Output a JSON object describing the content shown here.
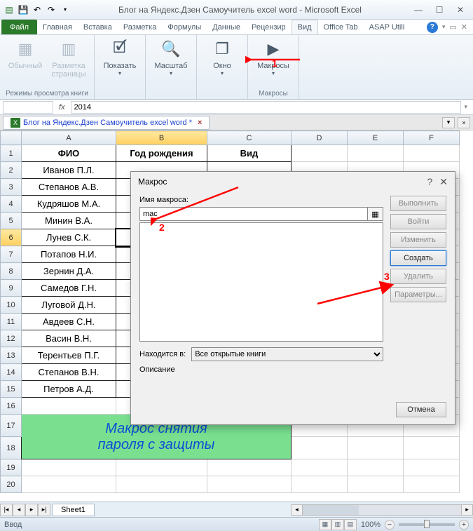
{
  "titlebar": {
    "title": "Блог на Яндекс.Дзен Самоучитель excel word  -  Microsoft Excel"
  },
  "ribbon": {
    "file": "Файл",
    "tabs": [
      "Главная",
      "Вставка",
      "Разметка",
      "Формулы",
      "Данные",
      "Рецензир",
      "Вид",
      "Office Tab",
      "ASAP Utili"
    ],
    "active_tab": "Вид",
    "groups": {
      "views": {
        "normal": "Обычный",
        "page_layout": "Разметка\nстраницы",
        "name": "Режимы просмотра книги"
      },
      "show": {
        "btn": "Показать"
      },
      "zoom": {
        "btn": "Масштаб"
      },
      "window": {
        "btn": "Окно"
      },
      "macros": {
        "btn": "Макросы",
        "name": "Макросы"
      }
    }
  },
  "formula_bar": {
    "fx": "fx",
    "value": "2014"
  },
  "workbook_tab": {
    "label": "Блог на Яндекс.Дзен Самоучитель excel word *"
  },
  "grid": {
    "columns": [
      "A",
      "B",
      "C",
      "D",
      "E",
      "F"
    ],
    "active_row": 6,
    "active_col": "B",
    "headers": {
      "A": "ФИО",
      "B": "Год рождения",
      "C": "Вид"
    },
    "rows": [
      {
        "n": 2,
        "A": "Иванов П.Л."
      },
      {
        "n": 3,
        "A": "Степанов А.В."
      },
      {
        "n": 4,
        "A": "Кудряшов М.А."
      },
      {
        "n": 5,
        "A": "Минин В.А."
      },
      {
        "n": 6,
        "A": "Лунев С.К."
      },
      {
        "n": 7,
        "A": "Потапов Н.И."
      },
      {
        "n": 8,
        "A": "Зернин Д.А."
      },
      {
        "n": 9,
        "A": "Самедов Г.Н."
      },
      {
        "n": 10,
        "A": "Луговой Д.Н."
      },
      {
        "n": 11,
        "A": "Авдеев С.Н."
      },
      {
        "n": 12,
        "A": "Васин В.Н."
      },
      {
        "n": 13,
        "A": "Терентьев П.Г."
      },
      {
        "n": 14,
        "A": "Степанов В.Н."
      },
      {
        "n": 15,
        "A": "Петров А.Д."
      }
    ],
    "banner_line1": "Макрос снятия",
    "banner_line2": "пароля с защиты"
  },
  "sheet_tabs": {
    "sheet1": "Sheet1"
  },
  "statusbar": {
    "mode": "Ввод",
    "zoom": "100%"
  },
  "dialog": {
    "title": "Макрос",
    "name_label": "Имя макроса:",
    "name_value": "mac",
    "location_label": "Находится в:",
    "location_value": "Все открытые книги",
    "desc_label": "Описание",
    "buttons": {
      "run": "Выполнить",
      "step": "Войти",
      "edit": "Изменить",
      "create": "Создать",
      "delete": "Удалить",
      "options": "Параметры...",
      "cancel": "Отмена"
    }
  },
  "annotations": {
    "n1": "1",
    "n2": "2",
    "n3": "3"
  }
}
